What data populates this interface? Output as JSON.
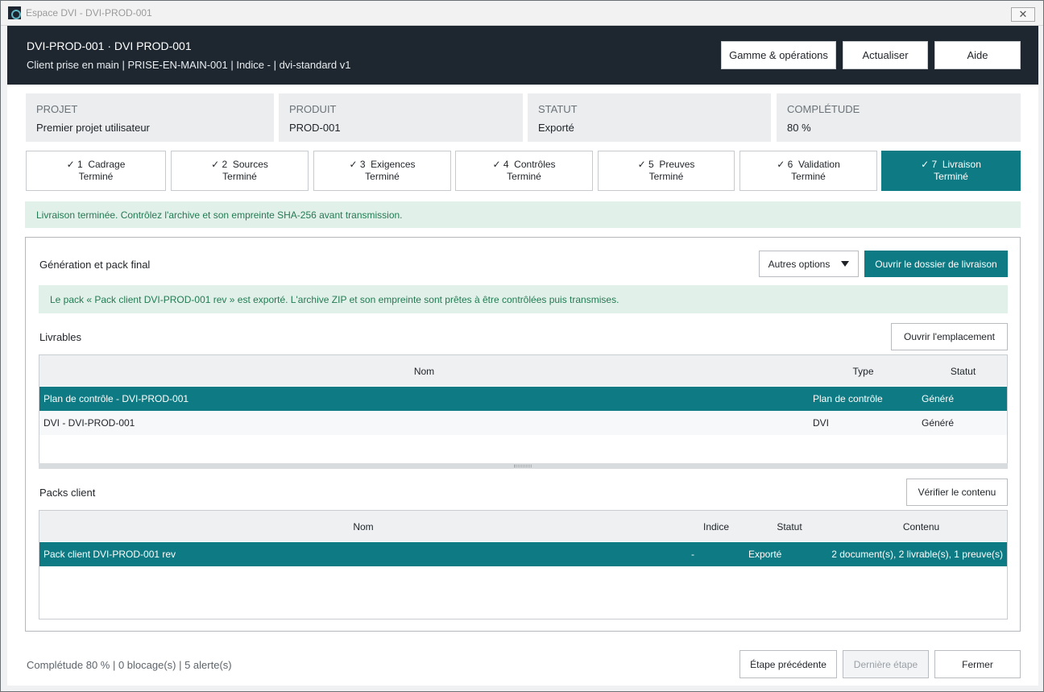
{
  "window": {
    "title": "Espace DVI - DVI-PROD-001",
    "close_glyph": "✕"
  },
  "header": {
    "title": "DVI-PROD-001  ·  DVI PROD-001",
    "subtitle": "Client prise en main  |  PRISE-EN-MAIN-001  |  Indice -  |  dvi-standard v1",
    "buttons": {
      "gamme": "Gamme & opérations",
      "refresh": "Actualiser",
      "help": "Aide"
    }
  },
  "info": [
    {
      "label": "PROJET",
      "value": "Premier projet utilisateur"
    },
    {
      "label": "PRODUIT",
      "value": "PROD-001"
    },
    {
      "label": "STATUT",
      "value": "Exporté"
    },
    {
      "label": "COMPLÉTUDE",
      "value": "80 %"
    }
  ],
  "steps": [
    {
      "title": "✓ 1  Cadrage",
      "status": "Terminé"
    },
    {
      "title": "✓ 2  Sources",
      "status": "Terminé"
    },
    {
      "title": "✓ 3  Exigences",
      "status": "Terminé"
    },
    {
      "title": "✓ 4  Contrôles",
      "status": "Terminé"
    },
    {
      "title": "✓ 5  Preuves",
      "status": "Terminé"
    },
    {
      "title": "✓ 6  Validation",
      "status": "Terminé"
    },
    {
      "title": "✓ 7  Livraison",
      "status": "Terminé"
    }
  ],
  "banner": "Livraison terminée. Contrôlez l'archive et son empreinte SHA-256 avant transmission.",
  "panel": {
    "title": "Génération et pack final",
    "more_options": "Autres options",
    "open_delivery": "Ouvrir le dossier de livraison",
    "pack_message": "Le pack « Pack client DVI-PROD-001 rev » est exporté. L'archive ZIP et son empreinte sont prêtes à être contrôlées puis transmises.",
    "deliverables": {
      "title": "Livrables",
      "open_location": "Ouvrir l'emplacement",
      "columns": {
        "name": "Nom",
        "type": "Type",
        "status": "Statut"
      },
      "rows": [
        {
          "name": "Plan de contrôle - DVI-PROD-001",
          "type": "Plan de contrôle",
          "status": "Généré"
        },
        {
          "name": "DVI - DVI-PROD-001",
          "type": "DVI",
          "status": "Généré"
        }
      ]
    },
    "packs": {
      "title": "Packs client",
      "verify": "Vérifier le contenu",
      "columns": {
        "name": "Nom",
        "index": "Indice",
        "status": "Statut",
        "content": "Contenu"
      },
      "rows": [
        {
          "name": "Pack client DVI-PROD-001 rev",
          "index": "-",
          "status": "Exporté",
          "content": "2 document(s), 2 livrable(s), 1 preuve(s)"
        }
      ]
    }
  },
  "footer": {
    "status": "Complétude 80 %  |  0 blocage(s)  |  5 alerte(s)",
    "prev": "Étape précédente",
    "last": "Dernière étape",
    "close": "Fermer"
  },
  "colors": {
    "accent": "#0e7a83",
    "header": "#1e2730",
    "success_bg": "#e1f1ea",
    "success_text": "#237a52"
  }
}
